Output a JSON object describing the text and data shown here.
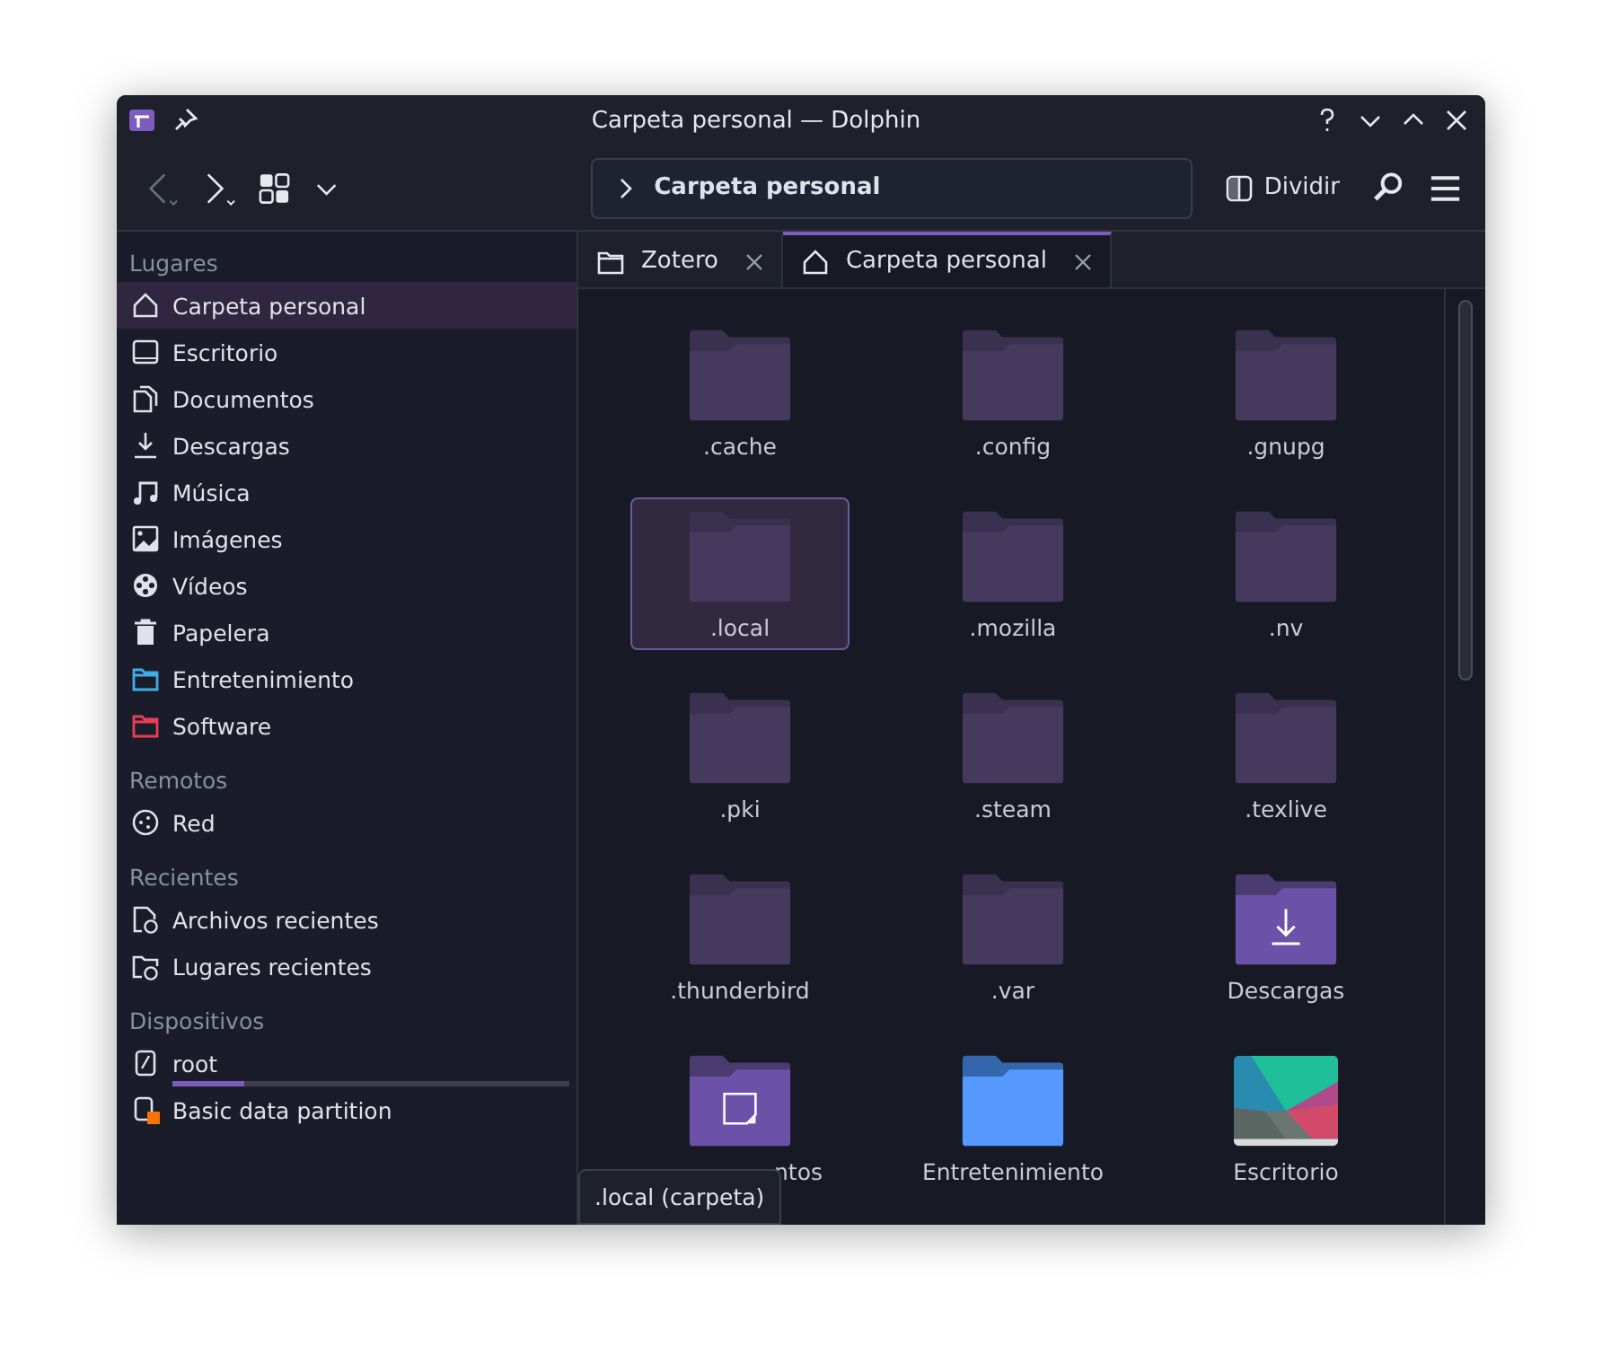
{
  "window": {
    "title": "Carpeta personal — Dolphin"
  },
  "toolbar": {
    "back": {
      "disabled": true
    },
    "forward": {
      "disabled": false
    },
    "split_button": {
      "label": "Dividir"
    }
  },
  "address_bar": {
    "path": "Carpeta personal"
  },
  "tabs": [
    {
      "label": "Zotero",
      "kind": "folder",
      "selected": false
    },
    {
      "label": "Carpeta personal",
      "kind": "home",
      "selected": true
    }
  ],
  "sidebar": {
    "sections": [
      {
        "heading": "Lugares",
        "items": [
          {
            "label": "Carpeta personal",
            "kind": "home",
            "selected": true
          },
          {
            "label": "Escritorio",
            "kind": "desktop",
            "selected": false
          },
          {
            "label": "Documentos",
            "kind": "documents",
            "selected": false
          },
          {
            "label": "Descargas",
            "kind": "downloads",
            "selected": false
          },
          {
            "label": "Música",
            "kind": "music",
            "selected": false
          },
          {
            "label": "Imágenes",
            "kind": "pictures",
            "selected": false
          },
          {
            "label": "Vídeos",
            "kind": "videos",
            "selected": false
          },
          {
            "label": "Papelera",
            "kind": "trash",
            "selected": false
          },
          {
            "label": "Entretenimiento",
            "kind": "folder",
            "color": "#3daee9",
            "selected": false
          },
          {
            "label": "Software",
            "kind": "folder",
            "color": "#e93d58",
            "selected": false
          }
        ]
      },
      {
        "heading": "Remotos",
        "items": [
          {
            "label": "Red",
            "kind": "network",
            "selected": false
          }
        ]
      },
      {
        "heading": "Recientes",
        "items": [
          {
            "label": "Archivos recientes",
            "kind": "recent-files",
            "selected": false
          },
          {
            "label": "Lugares recientes",
            "kind": "recent-places",
            "selected": false
          }
        ]
      },
      {
        "heading": "Dispositivos",
        "items": [
          {
            "label": "root",
            "kind": "drive",
            "level": 0.18,
            "selected": false
          },
          {
            "label": "Basic data partition",
            "kind": "partition",
            "selected": false
          }
        ]
      }
    ]
  },
  "files": [
    {
      "label": ".cache",
      "kind": "hidden",
      "selected": false
    },
    {
      "label": ".config",
      "kind": "hidden",
      "selected": false
    },
    {
      "label": ".gnupg",
      "kind": "hidden",
      "selected": false
    },
    {
      "label": ".local",
      "kind": "hidden",
      "selected": true
    },
    {
      "label": ".mozilla",
      "kind": "hidden",
      "selected": false
    },
    {
      "label": ".nv",
      "kind": "hidden",
      "selected": false
    },
    {
      "label": ".pki",
      "kind": "hidden",
      "selected": false
    },
    {
      "label": ".steam",
      "kind": "hidden",
      "selected": false
    },
    {
      "label": ".texlive",
      "kind": "hidden",
      "selected": false
    },
    {
      "label": ".thunderbird",
      "kind": "hidden",
      "selected": false
    },
    {
      "label": ".var",
      "kind": "hidden",
      "selected": false
    },
    {
      "label": "Descargas",
      "kind": "downloads",
      "selected": false
    },
    {
      "label": "ntos",
      "kind": "documents",
      "covered": true,
      "selected": false
    },
    {
      "label": "Entretenimiento",
      "kind": "blue",
      "selected": false
    },
    {
      "label": "Escritorio",
      "kind": "picture",
      "selected": false
    }
  ],
  "tooltip": {
    "text": ".local (carpeta)"
  }
}
